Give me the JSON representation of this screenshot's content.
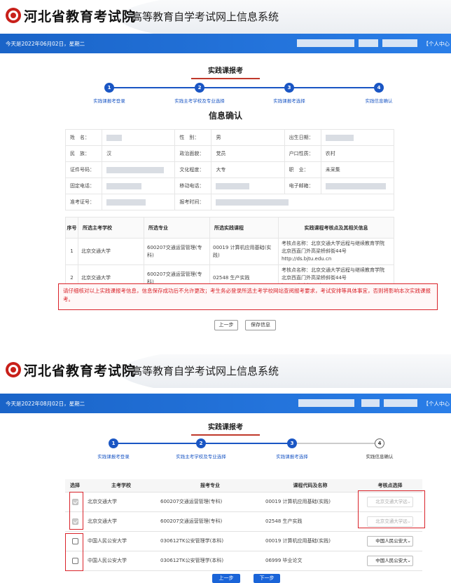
{
  "header": {
    "org": "河北省教育考试院",
    "system": "高等教育自学考试网上信息系统",
    "user_center": "【个人中心"
  },
  "panel1": {
    "date": "今天是2022年06月02日，星期二",
    "title": "实践课报考",
    "steps": [
      "实践课报考登录",
      "实践主考学校及专业选择",
      "实践课报考选择",
      "实践信息确认"
    ],
    "section": "信息确认",
    "info": {
      "name_label": "姓　名：",
      "gender_label": "性　别：",
      "gender": "男",
      "birth_label": "出生日期：",
      "nation_label": "民　族：",
      "nation": "汉",
      "politics_label": "政治面貌：",
      "politics": "党员",
      "hukou_label": "户口性质：",
      "hukou": "农村",
      "id_label": "证件号码：",
      "edu_label": "文化程度：",
      "edu": "大专",
      "job_label": "职　业：",
      "job": "未采集",
      "phone_label": "固定电话：",
      "mobile_label": "移动电话：",
      "email_label": "电子邮箱：",
      "ticket_label": "准考证号：",
      "regtime_label": "报考时间："
    },
    "course_headers": [
      "序号",
      "所选主考学校",
      "所选专业",
      "所选实践课程",
      "实践课程考核点及其相关信息"
    ],
    "courses": [
      {
        "no": "1",
        "school": "北京交通大学",
        "major": "600207交通运营管理(专科)",
        "course": "00019 计算机应用基础(实践)",
        "site": "考核点名称：北京交通大学远程与继续教育学院 北京西直门外高梁桥斜街44号 http://ds.bjtu.edu.cn"
      },
      {
        "no": "2",
        "school": "北京交通大学",
        "major": "600207交通运营管理(专科)",
        "course": "02548 生产实践",
        "site": "考核点名称：北京交通大学远程与继续教育学院 北京西直门外高梁桥斜街44号 http://ds.bjtu.edu.cn"
      }
    ],
    "warning": "请仔细核对以上实践课报考信息，信息保存成功后不允许更改；考生务必登录所选主考学校网站查阅报考要求，考试安排等具体事宜，否则将影响本次实践课报考。",
    "prev_button": "上一步",
    "save_button": "保存信息"
  },
  "panel2": {
    "date": "今天是2022年08月02日，星期二",
    "title": "实践课报考",
    "steps": [
      "实践课报考登录",
      "实践主考学校及专业选择",
      "实践课报考选择",
      "实践信息确认"
    ],
    "active_step": 3,
    "table_headers": [
      "选择",
      "主考学校",
      "报考专业",
      "课程代码及名称",
      "考核点选择"
    ],
    "rows": [
      {
        "school": "北京交通大学",
        "major": "600207交通运营管理(专科)",
        "course": "00019 计算机应用基础(实践)",
        "site": "北京交通大学远",
        "checked": true,
        "disabled": true
      },
      {
        "school": "北京交通大学",
        "major": "600207交通运营管理(专科)",
        "course": "02548 生产实践",
        "site": "北京交通大学远",
        "checked": true,
        "disabled": true
      },
      {
        "school": "中国人民公安大学",
        "major": "030612TK公安管理学(本科)",
        "course": "00019 计算机应用基础(实践)",
        "site": "中国人民公安大",
        "checked": false,
        "disabled": false
      },
      {
        "school": "中国人民公安大学",
        "major": "030612TK公安管理学(本科)",
        "course": "06999 毕业论文",
        "site": "中国人民公安大",
        "checked": false,
        "disabled": false
      }
    ],
    "prev_button": "上一步",
    "next_button": "下一步"
  },
  "colors": {
    "primary": "#1a64c8",
    "warning": "#d9232a",
    "brand": "#c8201a"
  }
}
